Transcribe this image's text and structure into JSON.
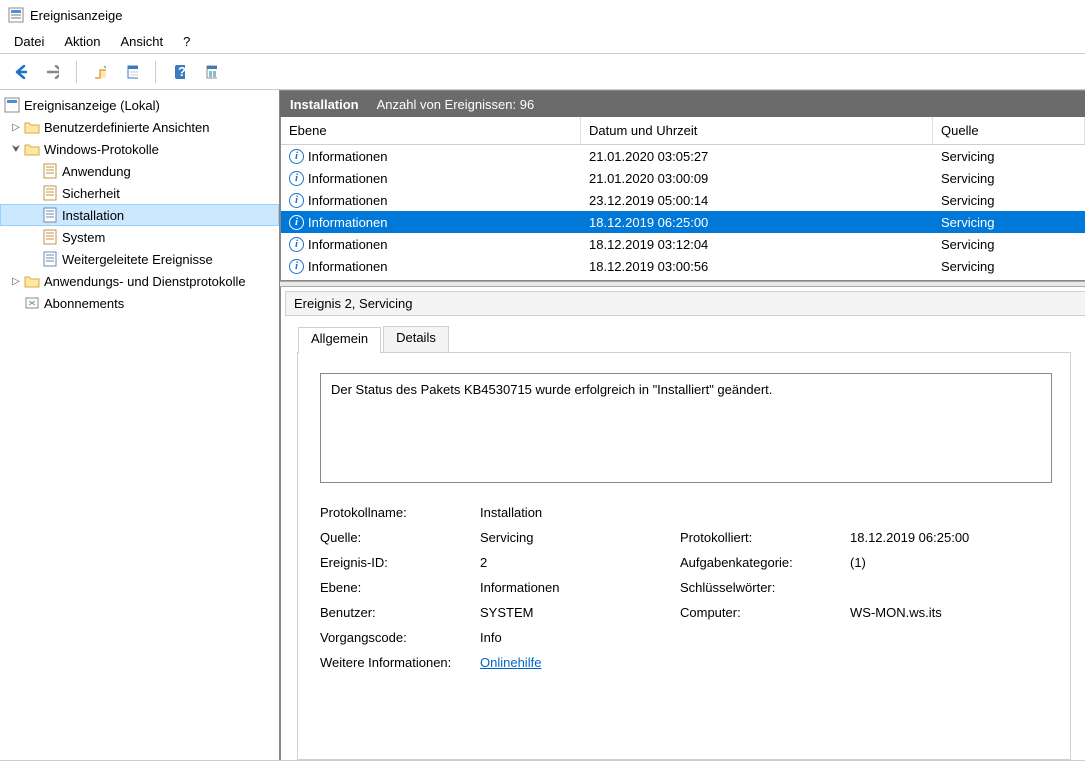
{
  "window": {
    "title": "Ereignisanzeige"
  },
  "menu": {
    "file": "Datei",
    "action": "Aktion",
    "view": "Ansicht",
    "help": "?"
  },
  "tree": {
    "root": "Ereignisanzeige (Lokal)",
    "custom_views": "Benutzerdefinierte Ansichten",
    "windows_logs": "Windows-Protokolle",
    "app": "Anwendung",
    "security": "Sicherheit",
    "setup": "Installation",
    "system": "System",
    "forwarded": "Weitergeleitete Ereignisse",
    "apps_services": "Anwendungs- und Dienstprotokolle",
    "subscriptions": "Abonnements"
  },
  "header": {
    "log_name": "Installation",
    "count_label": "Anzahl von Ereignissen: 96"
  },
  "columns": {
    "level": "Ebene",
    "date": "Datum und Uhrzeit",
    "source": "Quelle"
  },
  "rows": [
    {
      "level": "Informationen",
      "date": "21.01.2020 03:05:27",
      "source": "Servicing",
      "selected": false
    },
    {
      "level": "Informationen",
      "date": "21.01.2020 03:00:09",
      "source": "Servicing",
      "selected": false
    },
    {
      "level": "Informationen",
      "date": "23.12.2019 05:00:14",
      "source": "Servicing",
      "selected": false
    },
    {
      "level": "Informationen",
      "date": "18.12.2019 06:25:00",
      "source": "Servicing",
      "selected": true
    },
    {
      "level": "Informationen",
      "date": "18.12.2019 03:12:04",
      "source": "Servicing",
      "selected": false
    },
    {
      "level": "Informationen",
      "date": "18.12.2019 03:00:56",
      "source": "Servicing",
      "selected": false
    }
  ],
  "detail": {
    "title": "Ereignis 2, Servicing",
    "tab_general": "Allgemein",
    "tab_details": "Details",
    "message": "Der Status des Pakets KB4530715 wurde erfolgreich in \"Installiert\" geändert.",
    "labels": {
      "log": "Protokollname:",
      "source": "Quelle:",
      "logged": "Protokolliert:",
      "eventid": "Ereignis-ID:",
      "category": "Aufgabenkategorie:",
      "level": "Ebene:",
      "keywords": "Schlüsselwörter:",
      "user": "Benutzer:",
      "computer": "Computer:",
      "opcode": "Vorgangscode:",
      "moreinfo": "Weitere Informationen:"
    },
    "values": {
      "log": "Installation",
      "source": "Servicing",
      "logged": "18.12.2019 06:25:00",
      "eventid": "2",
      "category": "(1)",
      "level": "Informationen",
      "keywords": "",
      "user": "SYSTEM",
      "computer": "WS-MON.ws.its",
      "opcode": "Info",
      "help_link": "Onlinehilfe"
    }
  }
}
